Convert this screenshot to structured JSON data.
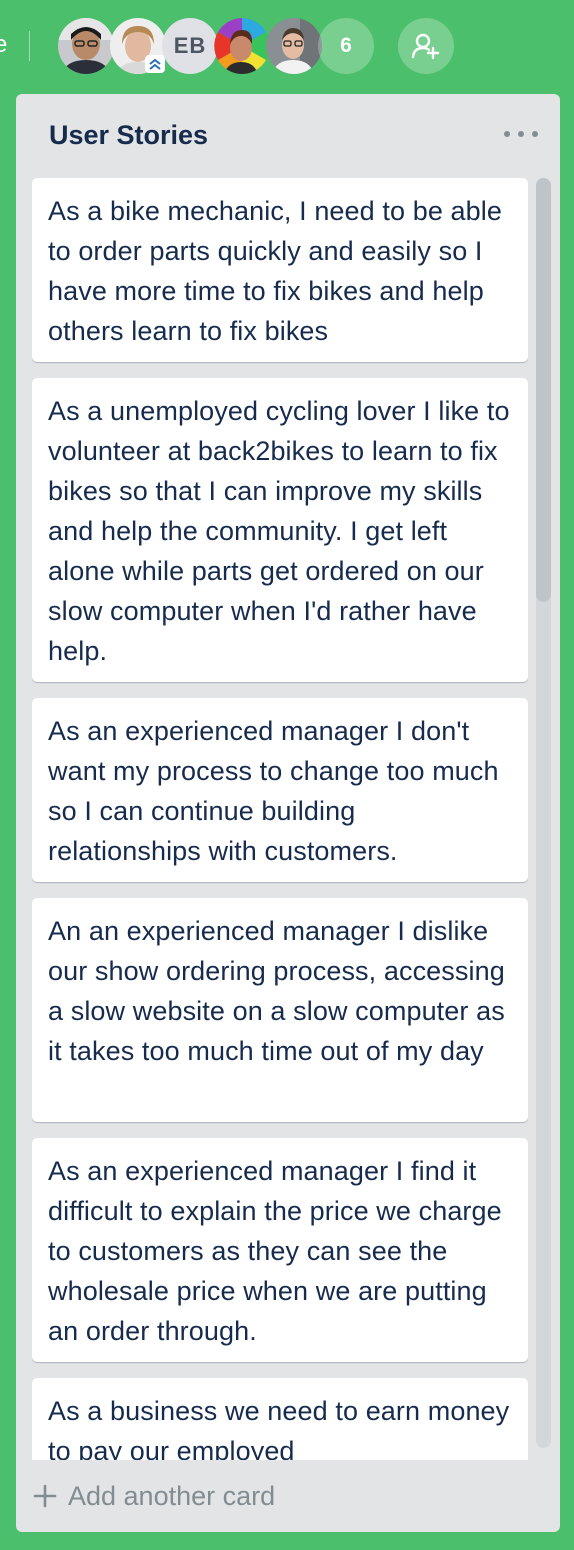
{
  "header": {
    "edge_char": "e",
    "members": [
      {
        "name": "member-avatar-1",
        "type": "photo"
      },
      {
        "name": "member-avatar-2",
        "type": "photo",
        "admin": true
      },
      {
        "name": "member-avatar-3",
        "type": "initials",
        "initials": "EB"
      },
      {
        "name": "member-avatar-4",
        "type": "photo"
      },
      {
        "name": "member-avatar-5",
        "type": "photo"
      }
    ],
    "more_members_count": "6",
    "icons": {
      "admin_badge": "chevron-double-up-icon",
      "invite": "add-member-icon"
    }
  },
  "list": {
    "title": "User Stories",
    "menu_icon": "ellipsis-icon",
    "cards": [
      "As a bike mechanic, I need to be able to order parts quickly and easily so I have more time to fix bikes and help others learn to fix bikes",
      "As a unemployed cycling lover I like to volunteer at back2bikes to learn to fix bikes so that I can improve my skills and help the community. I get left alone while parts get ordered on our slow computer when I'd rather have help.",
      "As an experienced manager I don't want my process to change too much so I can continue building relationships with customers.",
      "An an experienced manager I dislike our show ordering process, accessing a slow website on a slow computer as it takes too much time out of my day",
      "As an experienced manager I find it difficult to explain the price we charge to customers as they can see the wholesale price when we are putting an order through.",
      "As a business we need to earn money to pay our employed"
    ],
    "add_card_label": "Add another card"
  },
  "colors": {
    "board_background": "#4bbf6b",
    "list_background": "#e2e4e6",
    "card_background": "#ffffff",
    "text": "#172b4d",
    "muted": "#838c91"
  }
}
